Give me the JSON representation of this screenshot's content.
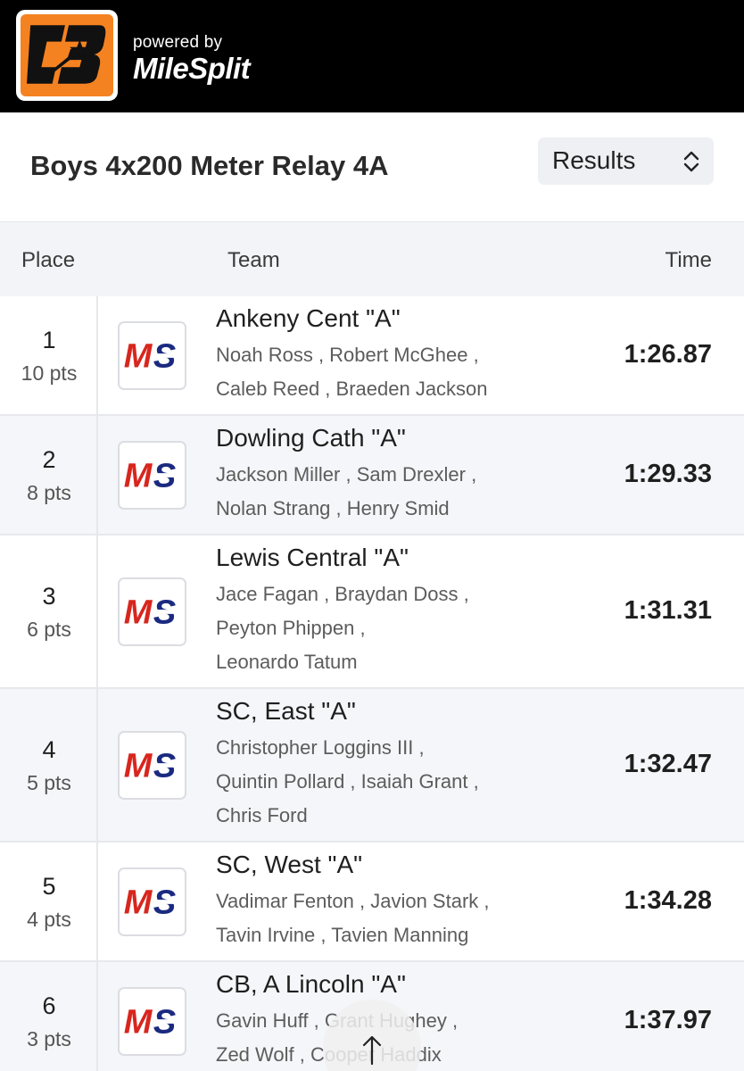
{
  "header": {
    "powered_by": "powered by",
    "brand": "MileSplit",
    "logo_icon": "cb-logo-icon"
  },
  "event": {
    "title": "Boys 4x200 Meter Relay 4A",
    "view_select": "Results"
  },
  "table": {
    "columns": {
      "place": "Place",
      "team": "Team",
      "time": "Time"
    },
    "rows": [
      {
        "place": "1",
        "points": "10 pts",
        "team": "Ankeny Cent \"A\"",
        "runners": [
          "Noah Ross , Robert McGhee ,",
          "Caleb Reed , Braeden Jackson"
        ],
        "time": "1:26.87"
      },
      {
        "place": "2",
        "points": "8 pts",
        "team": "Dowling Cath \"A\"",
        "runners": [
          "Jackson Miller , Sam Drexler ,",
          "Nolan Strang , Henry Smid"
        ],
        "time": "1:29.33"
      },
      {
        "place": "3",
        "points": "6 pts",
        "team": "Lewis Central \"A\"",
        "runners": [
          "Jace Fagan , Braydan Doss ,",
          "Peyton Phippen ,",
          "Leonardo Tatum"
        ],
        "time": "1:31.31"
      },
      {
        "place": "4",
        "points": "5 pts",
        "team": "SC, East \"A\"",
        "runners": [
          "Christopher Loggins III ,",
          "Quintin Pollard , Isaiah Grant ,",
          "Chris Ford"
        ],
        "time": "1:32.47"
      },
      {
        "place": "5",
        "points": "4 pts",
        "team": "SC, West \"A\"",
        "runners": [
          "Vadimar Fenton , Javion Stark ,",
          "Tavin Irvine , Tavien Manning"
        ],
        "time": "1:34.28"
      },
      {
        "place": "6",
        "points": "3 pts",
        "team": "CB, A Lincoln \"A\"",
        "runners": [
          "Gavin Huff , Grant Hughey ,",
          "Zed Wolf , Cooper Haddix"
        ],
        "time": "1:37.97"
      }
    ]
  },
  "colors": {
    "brand_orange": "#f58220",
    "ms_red": "#d7261e",
    "ms_navy": "#1b2a80"
  }
}
